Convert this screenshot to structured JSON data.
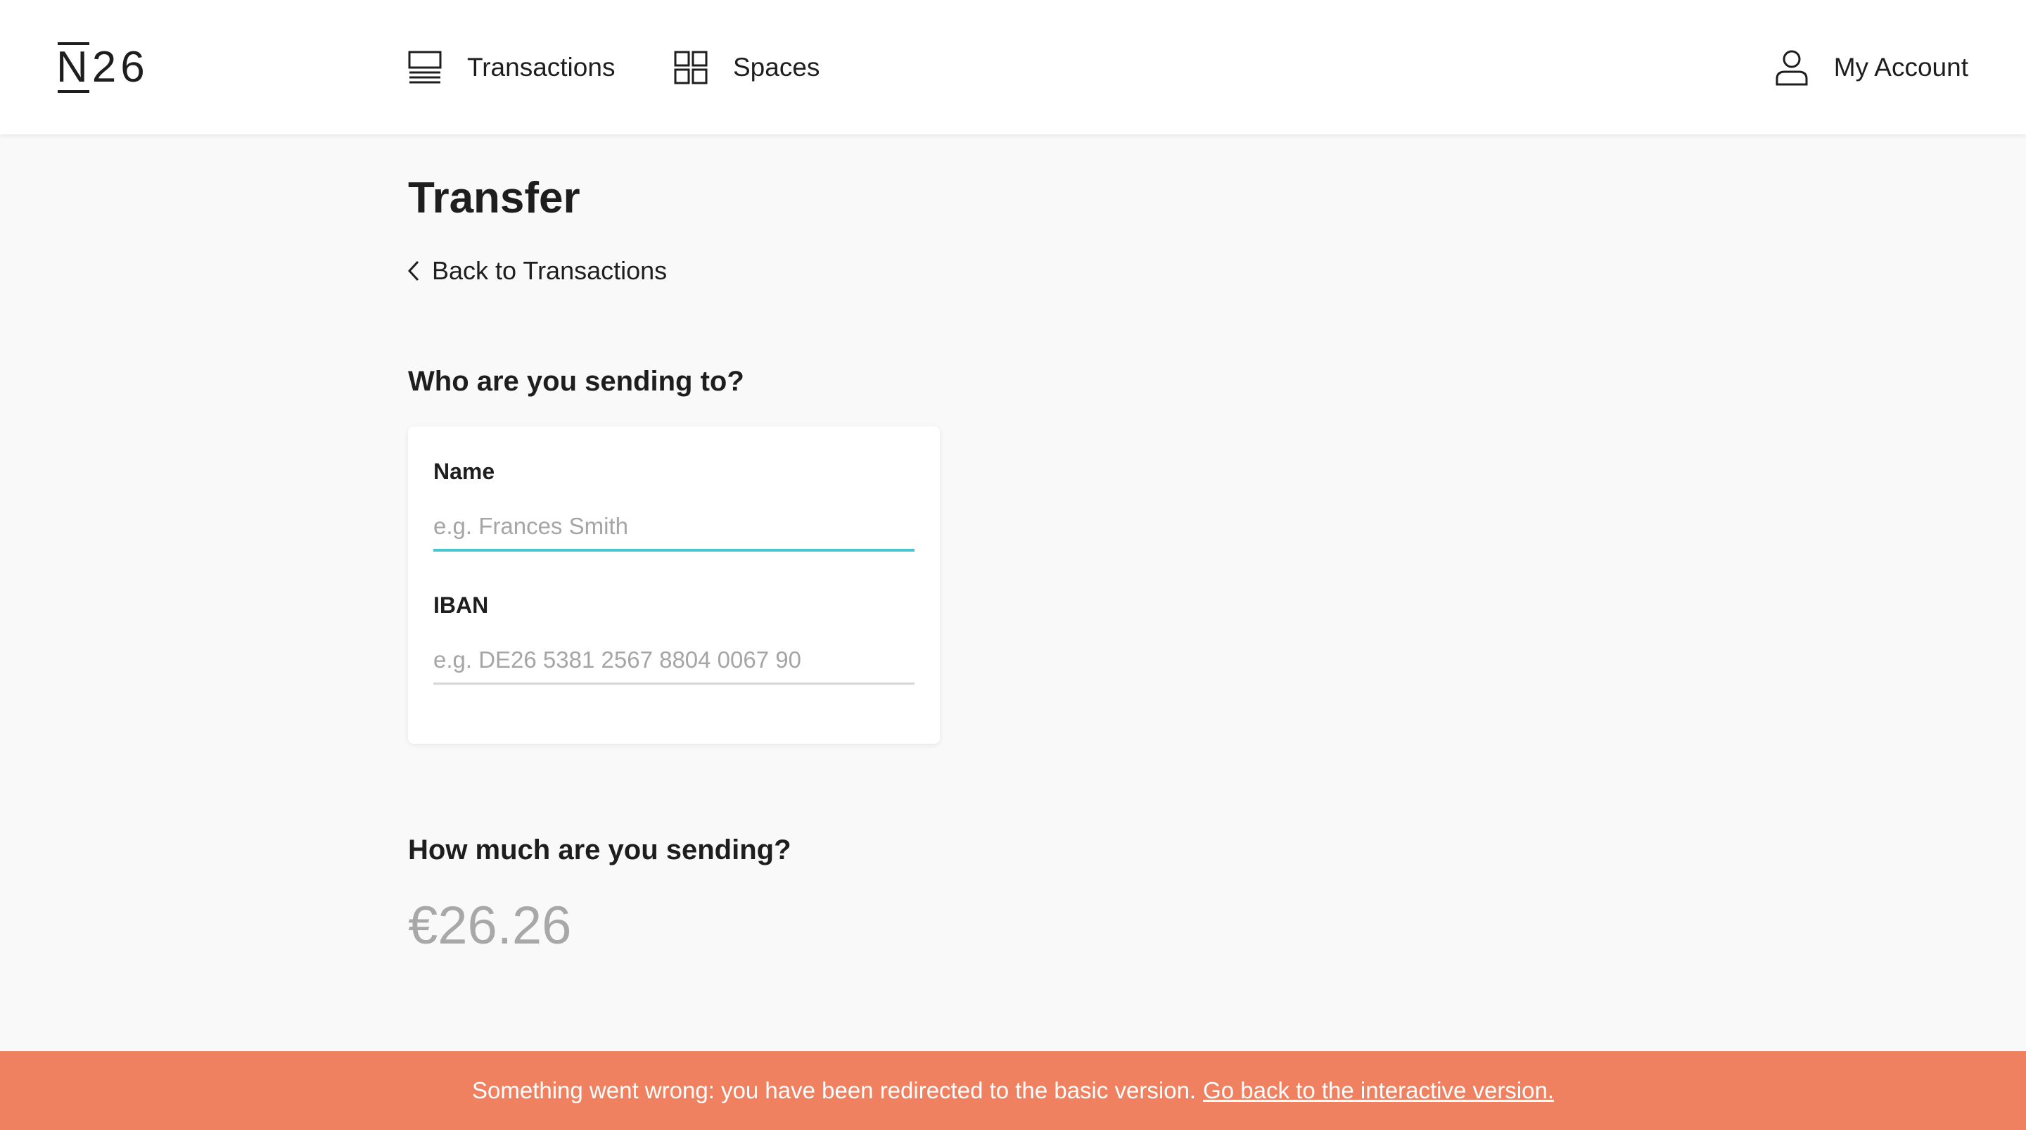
{
  "header": {
    "logo_text": "26",
    "logo_letter": "N",
    "nav": {
      "transactions": {
        "label": "Transactions",
        "icon": "transactions-icon"
      },
      "spaces": {
        "label": "Spaces",
        "icon": "spaces-icon"
      },
      "account": {
        "label": "My Account",
        "icon": "user-icon"
      }
    }
  },
  "main": {
    "title": "Transfer",
    "back_label": "Back to Transactions",
    "recipient": {
      "heading": "Who are you sending to?",
      "name_label": "Name",
      "name_placeholder": "e.g. Frances Smith",
      "name_value": "",
      "iban_label": "IBAN",
      "iban_placeholder": "e.g. DE26 5381 2567 8804 0067 90",
      "iban_value": ""
    },
    "amount": {
      "heading": "How much are you sending?",
      "value": "€26.26"
    }
  },
  "banner": {
    "message": "Something went wrong: you have been redirected to the basic version.",
    "link": "Go back to the interactive version."
  },
  "colors": {
    "accent": "#48c6cf",
    "banner_bg": "#ef8160",
    "background": "#f9f9f9"
  }
}
